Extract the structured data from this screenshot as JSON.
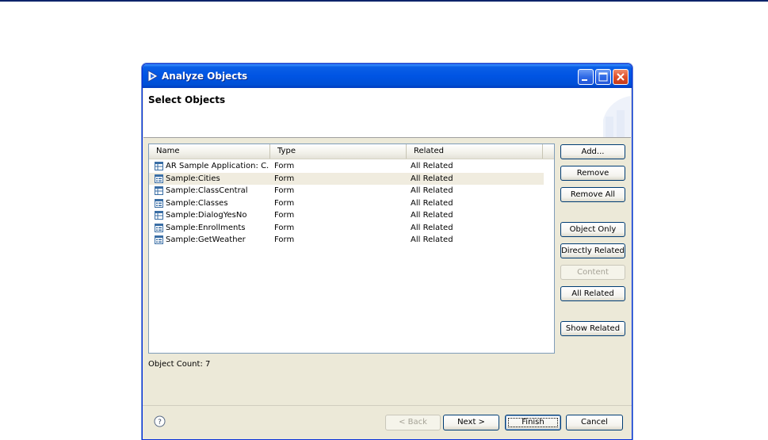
{
  "window": {
    "title": "Analyze Objects"
  },
  "banner": {
    "title": "Select Objects"
  },
  "table": {
    "columns": [
      "Name",
      "Type",
      "Related"
    ],
    "rows": [
      {
        "name": "AR Sample Application: C...",
        "type": "Form",
        "related": "All Related",
        "icon": "form-icon-table"
      },
      {
        "name": "Sample:Cities",
        "type": "Form",
        "related": "All Related",
        "icon": "form-icon-grid",
        "selected": true
      },
      {
        "name": "Sample:ClassCentral",
        "type": "Form",
        "related": "All Related",
        "icon": "form-icon-table"
      },
      {
        "name": "Sample:Classes",
        "type": "Form",
        "related": "All Related",
        "icon": "form-icon-grid"
      },
      {
        "name": "Sample:DialogYesNo",
        "type": "Form",
        "related": "All Related",
        "icon": "form-icon-table"
      },
      {
        "name": "Sample:Enrollments",
        "type": "Form",
        "related": "All Related",
        "icon": "form-icon-grid"
      },
      {
        "name": "Sample:GetWeather",
        "type": "Form",
        "related": "All Related",
        "icon": "form-icon-grid"
      }
    ]
  },
  "status": {
    "object_count": "Object Count: 7"
  },
  "side_buttons": {
    "add": "Add...",
    "remove": "Remove",
    "remove_all": "Remove All",
    "object_only": "Object Only",
    "directly_related": "Directly Related",
    "content": "Content",
    "all_related": "All Related",
    "show_related": "Show Related"
  },
  "footer": {
    "back": "< Back",
    "next": "Next >",
    "finish": "Finish",
    "cancel": "Cancel"
  },
  "colors": {
    "titlebar": "#0054e3",
    "dialog_bg": "#ece9d8",
    "selected_row": "#f0ecdf"
  }
}
